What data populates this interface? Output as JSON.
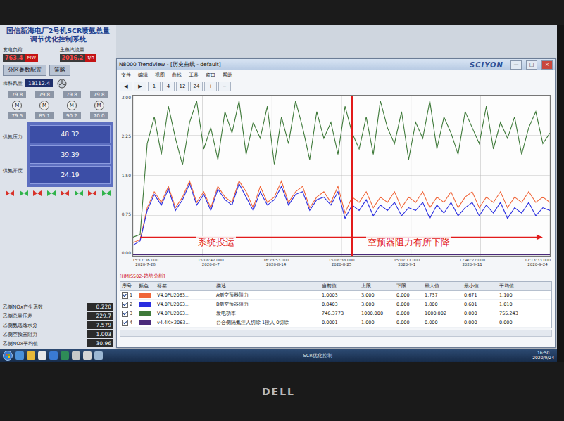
{
  "hmi": {
    "title": "国信新海电厂2号机SCR喷氨总量调节优化控制系统",
    "readouts": [
      {
        "label": "发电负荷",
        "value": "763.4",
        "unit": "MW"
      },
      {
        "label": "主蒸汽流量",
        "value": "2016.2",
        "unit": "t/h"
      }
    ],
    "buttons": [
      "分区参数配置",
      "策略"
    ],
    "flow": {
      "label": "稀释风量",
      "value": "13112.4"
    },
    "side_labels": [
      "供氨压力",
      "供氨开度"
    ],
    "valve_mark": "M",
    "valves_top": [
      "79.8",
      "79.8",
      "79.8",
      "79.8"
    ],
    "valves_bottom": [
      "79.5",
      "85.1",
      "90.2",
      "70.0"
    ],
    "blocks": [
      "48.32",
      "39.39",
      "24.19"
    ],
    "gates": [
      {
        "open": false
      },
      {
        "open": true
      },
      {
        "open": false
      },
      {
        "open": true
      },
      {
        "open": false
      },
      {
        "open": true
      },
      {
        "open": false
      },
      {
        "open": true
      }
    ],
    "stats": [
      {
        "label": "乙侧NOx产生系数",
        "value": "0.220"
      },
      {
        "label": "乙侧总量压差",
        "value": "229.7"
      },
      {
        "label": "乙侧氨逃逸水分",
        "value": "7.579"
      },
      {
        "label": "乙侧空预器阻力",
        "value": "1.003"
      },
      {
        "label": "乙侧NOx平均值",
        "value": "30.96"
      }
    ]
  },
  "window": {
    "title": "N8000 TrendView - [历史曲线 - default]",
    "logo": "SCIYON",
    "controls": [
      "—",
      "□",
      "×"
    ],
    "menu": [
      "文件",
      "编辑",
      "视图",
      "曲线",
      "工具",
      "窗口",
      "帮助"
    ],
    "toolbar": [
      "◀",
      "▶",
      "1",
      "4",
      "12",
      "24",
      "+",
      "−"
    ]
  },
  "chart": {
    "y_max": 3,
    "y_ticks": [
      "3.00",
      "2.25",
      "1.50",
      "0.75",
      "0.00"
    ],
    "x_ticks": [
      {
        "time": "15:17:36.000",
        "date": "2020-7-26"
      },
      {
        "time": "15:08:47.000",
        "date": "2020-8-7"
      },
      {
        "time": "16:23:53.000",
        "date": "2020-8-14"
      },
      {
        "time": "15:08:38.000",
        "date": "2020-8-25"
      },
      {
        "time": "15:07:11.000",
        "date": "2020-9-1"
      },
      {
        "time": "17:40:22.000",
        "date": "2020-9-11"
      },
      {
        "time": "17:13:33.000",
        "date": "2020-9-24"
      }
    ],
    "marker_index": 31,
    "arrow": {
      "from_index": 1,
      "to_index": 58,
      "value": 0.35
    },
    "annotations": [
      {
        "text": "系统投运",
        "index": 9
      },
      {
        "text": "空预器阻力有所下降",
        "index": 33
      }
    ],
    "series": [
      {
        "name": "发电功率",
        "color": "#3f7a3a",
        "values": [
          0.35,
          0.4,
          2.1,
          2.6,
          1.9,
          2.8,
          2.2,
          1.7,
          2.5,
          2.9,
          2.0,
          2.4,
          1.8,
          2.7,
          2.3,
          2.9,
          1.9,
          2.5,
          2.2,
          2.8,
          1.7,
          2.6,
          2.1,
          2.9,
          2.4,
          1.8,
          2.7,
          2.2,
          2.5,
          1.9,
          2.8,
          2.3,
          2.0,
          2.6,
          1.9,
          2.9,
          2.4,
          2.1,
          2.7,
          1.8,
          2.5,
          2.2,
          2.9,
          2.0,
          2.6,
          2.3,
          1.9,
          2.7,
          2.4,
          2.1,
          2.8,
          2.0,
          2.5,
          2.2,
          2.6,
          1.9,
          2.4,
          2.7,
          2.1,
          2.3
        ]
      },
      {
        "name": "A侧空预器阻力",
        "color": "#f0663a",
        "values": [
          0.25,
          0.3,
          0.9,
          1.2,
          1.0,
          1.3,
          0.9,
          1.1,
          1.4,
          1.0,
          1.2,
          0.9,
          1.3,
          1.1,
          1.0,
          1.4,
          1.2,
          0.9,
          1.3,
          1.0,
          1.1,
          1.4,
          1.0,
          1.2,
          1.3,
          0.9,
          1.1,
          1.2,
          1.0,
          1.3,
          0.8,
          1.1,
          1.0,
          1.2,
          0.9,
          1.1,
          1.0,
          1.2,
          0.9,
          1.1,
          1.0,
          1.2,
          0.9,
          1.1,
          1.0,
          1.2,
          0.9,
          1.1,
          1.2,
          0.9,
          1.1,
          1.0,
          1.2,
          0.9,
          1.1,
          1.0,
          1.2,
          1.0,
          1.1,
          1.0
        ]
      },
      {
        "name": "B侧空预器阻力",
        "color": "#2a2ee0",
        "values": [
          0.2,
          0.28,
          0.85,
          1.15,
          0.95,
          1.25,
          0.85,
          1.05,
          1.35,
          0.95,
          1.15,
          0.85,
          1.25,
          1.05,
          0.95,
          1.35,
          1.1,
          0.85,
          1.2,
          0.95,
          1.05,
          1.3,
          0.95,
          1.15,
          1.2,
          0.85,
          1.05,
          1.1,
          0.95,
          1.2,
          0.7,
          0.95,
          0.85,
          1.05,
          0.75,
          0.95,
          0.85,
          1.0,
          0.75,
          0.9,
          0.85,
          1.0,
          0.7,
          0.95,
          0.8,
          1.0,
          0.75,
          0.9,
          1.0,
          0.75,
          0.95,
          0.8,
          1.0,
          0.7,
          0.9,
          0.8,
          1.0,
          0.75,
          0.9,
          0.85
        ]
      },
      {
        "name": "台合侧隔氨注入切除",
        "color": "#4a2a7a",
        "values": [
          0.02,
          0.02,
          0.02,
          0.02,
          0.02,
          0.02,
          0.02,
          0.02,
          0.02,
          0.02,
          0.02,
          0.02,
          0.02,
          0.02,
          0.02,
          0.02,
          0.02,
          0.02,
          0.02,
          0.02,
          0.02,
          0.02,
          0.02,
          0.02,
          0.02,
          0.02,
          0.02,
          0.02,
          0.02,
          0.02,
          0.02,
          0.02,
          0.02,
          0.02,
          0.02,
          0.02,
          0.02,
          0.02,
          0.02,
          0.02,
          0.02,
          0.02,
          0.02,
          0.02,
          0.02,
          0.02,
          0.02,
          0.02,
          0.02,
          0.02,
          0.02,
          0.02,
          0.02,
          0.02,
          0.02,
          0.02,
          0.02,
          0.02,
          0.02,
          0.02
        ]
      }
    ]
  },
  "table": {
    "caption": "[HMIS502-趋势分析]",
    "columns": [
      "序号",
      "颜色",
      "标签",
      "描述",
      "当前值",
      "上限",
      "下限",
      "最大值",
      "最小值",
      "平均值"
    ],
    "rows": [
      {
        "checked": true,
        "index": "1",
        "color": "#f0663a",
        "tag": "V4.0PU2063...",
        "desc": "A侧空预器阻力",
        "current": "1.0003",
        "high": "3.000",
        "low": "0.000",
        "max": "1.737",
        "min": "0.671",
        "avg": "1.100"
      },
      {
        "checked": true,
        "index": "2",
        "color": "#2a2ee0",
        "tag": "V4.0PU2063...",
        "desc": "B侧空预器阻力",
        "current": "0.8403",
        "high": "3.000",
        "low": "0.000",
        "max": "1.800",
        "min": "0.601",
        "avg": "1.010"
      },
      {
        "checked": true,
        "index": "3",
        "color": "#3f7a3a",
        "tag": "V4.0PU2063...",
        "desc": "发电功率",
        "current": "746.3773",
        "high": "1000.000",
        "low": "0.000",
        "max": "1000.002",
        "min": "0.000",
        "avg": "755.243"
      },
      {
        "checked": true,
        "index": "4",
        "color": "#4a2a7a",
        "tag": "v4.4K×2063...",
        "desc": "台合侧隔氨注入切除 1投入 0切除",
        "current": "0.0001",
        "high": "1.000",
        "low": "0.000",
        "max": "0.000",
        "min": "0.000",
        "avg": "0.000"
      }
    ]
  },
  "taskbar": {
    "center": "SCR优化控制",
    "time": "16:50",
    "date": "2020/9/24"
  },
  "bezel": {
    "brand": "DELL"
  }
}
